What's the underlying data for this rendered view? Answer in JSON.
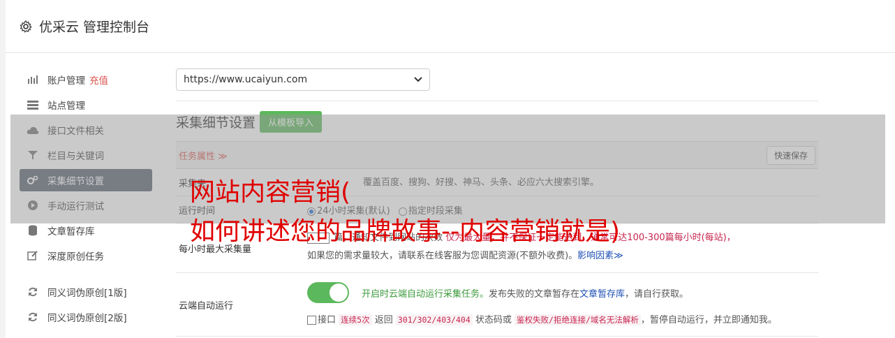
{
  "header": {
    "title": "优采云 管理控制台",
    "icon": "gear-icon"
  },
  "sidebar": {
    "items": [
      {
        "label": "账户管理",
        "badge": "充值",
        "icon": "bar-chart-icon"
      },
      {
        "label": "站点管理",
        "icon": "server-icon"
      },
      {
        "label": "接口文件相关",
        "icon": "cloud-upload-icon"
      },
      {
        "label": "栏目与关键词",
        "icon": "filter-icon"
      },
      {
        "label": "采集细节设置",
        "icon": "gears-icon",
        "active": true
      },
      {
        "label": "手动运行测试",
        "icon": "play-icon"
      },
      {
        "label": "文章暂存库",
        "icon": "database-icon"
      },
      {
        "label": "深度原创任务",
        "icon": "edit-icon"
      },
      {
        "label": "同义词伪原创[1版]",
        "icon": "refresh-icon"
      },
      {
        "label": "同义词伪原创[2版]",
        "icon": "refresh-icon"
      }
    ]
  },
  "main": {
    "site_select": "https://www.ucaiyun.com",
    "section_title": "采集细节设置",
    "import_button": "从模板导入",
    "task_attr": "任务属性",
    "task_attr_caret": "≫",
    "quick_save": "快速保存",
    "rows": {
      "source": {
        "label": "采集来",
        "text": "覆盖百度、搜狗、好搜、神马、头条、必应六大搜索引擎。"
      },
      "runtime": {
        "label": "运行时间",
        "opt1": "24小时采集(默认)",
        "opt2": "指定时段采集"
      },
      "maxcount": {
        "label": "每小时最大采集量",
        "line1_a": "篇，通知文件到网站的次数",
        "line1_b": "仅为最大量，并不保证一定能达到，通常可达100-300篇每小时(每站)，",
        "line2": "如果您的需求量较大，请联系在线客服为您调配资源(不额外收费)。",
        "link": "影响因素"
      },
      "cloud": {
        "label": "云端自动运行",
        "green": "开启时云端自动运行采集任务。",
        "text1": "发布失败的文章暂存在",
        "link": "文章暂存库",
        "text2": "，请自行获取。",
        "l2_a": "接口",
        "l2_code1": "连续5次",
        "l2_b": "返回",
        "l2_code2": "301/302/403/404",
        "l2_c": "状态码或",
        "l2_code3": "鉴权失败/拒绝连接/域名无法解析",
        "l2_d": "，暂停自动运行，并立即通知我。"
      }
    }
  },
  "overlay": {
    "line1": "网站内容营销(",
    "line2": "如何讲述您的品牌故事--内容营销就是)"
  }
}
